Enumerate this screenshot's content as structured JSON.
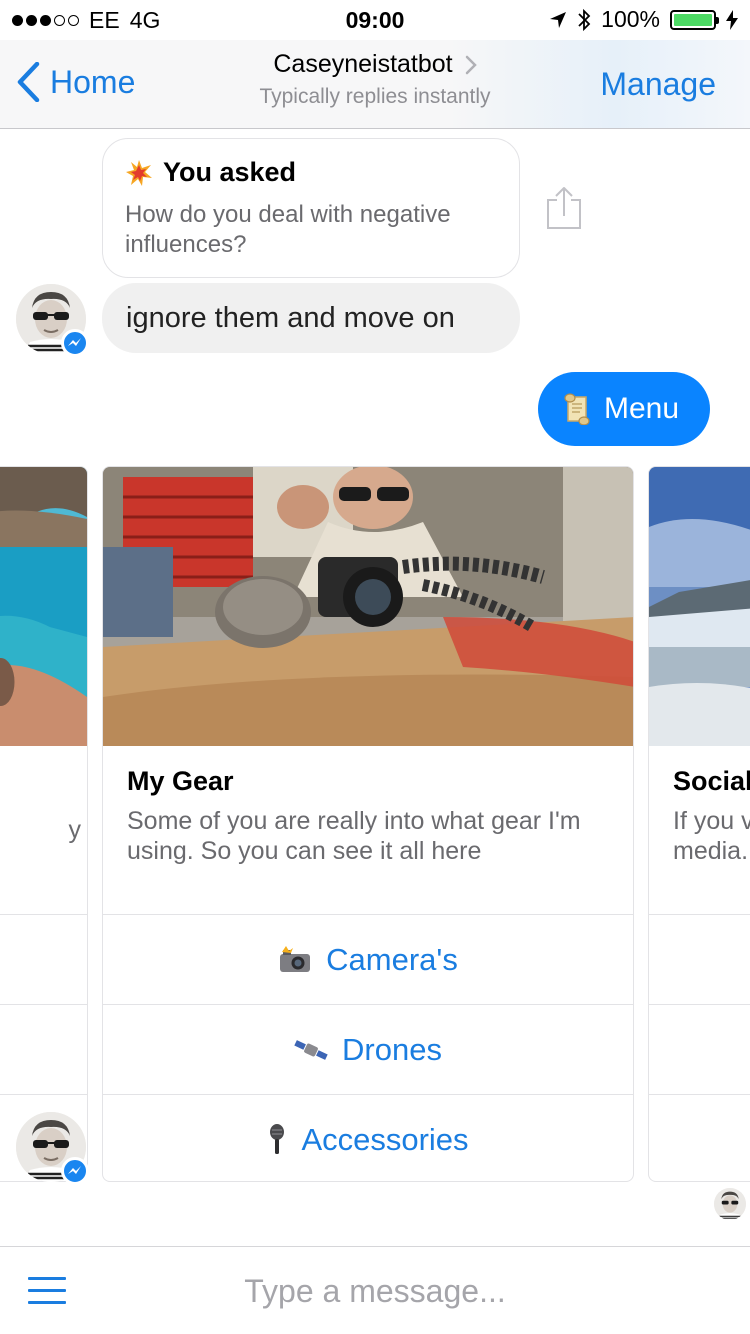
{
  "status_bar": {
    "carrier": "EE",
    "network": "4G",
    "time": "09:00",
    "battery": "100%",
    "signal_bars_filled": 3,
    "signal_bars_total": 5
  },
  "nav": {
    "back_label": "Home",
    "title": "Caseyneistatbot",
    "subtitle": "Typically replies instantly",
    "action_label": "Manage"
  },
  "messages": {
    "asked": {
      "icon": "collision-emoji",
      "title": "You asked",
      "question": "How do you deal with negative influences?"
    },
    "reply": "ignore them and move on",
    "menu": {
      "icon": "scroll-emoji",
      "label": "Menu"
    }
  },
  "carousel": {
    "main_card": {
      "title": "My Gear",
      "subtitle": "Some of you are really into what gear I'm using. So you can see it all here",
      "buttons": [
        {
          "icon": "camera-flash-emoji",
          "label": "Camera's"
        },
        {
          "icon": "satellite-emoji",
          "label": "Drones"
        },
        {
          "icon": "microphone-emoji",
          "label": "Accessories"
        }
      ]
    },
    "left_card": {
      "subtitle_fragment": "y"
    },
    "right_card": {
      "title": "Social",
      "subtitle_line1": "If you v",
      "subtitle_line2": "media."
    }
  },
  "composer": {
    "placeholder": "Type a message..."
  },
  "colors": {
    "accent": "#1a7de0",
    "bubble_blue": "#0a84ff",
    "battery_green": "#4cd964",
    "bubble_gray": "#f0f0f0",
    "secondary_text": "#8e8e93"
  }
}
